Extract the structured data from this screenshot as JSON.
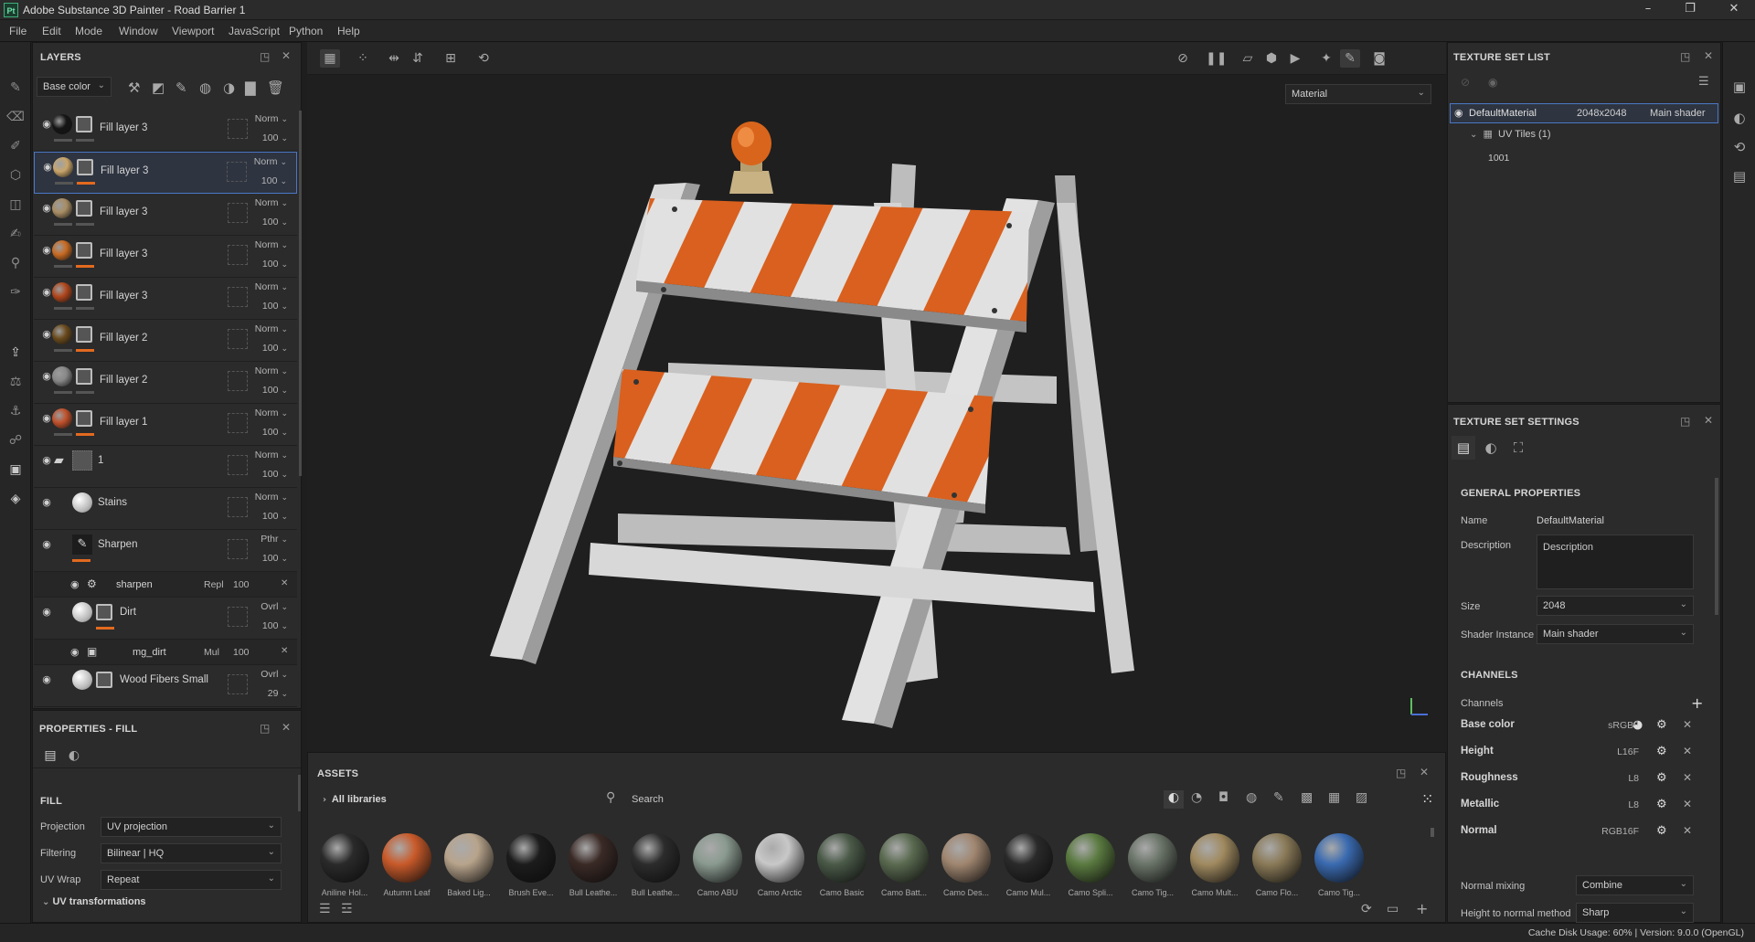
{
  "window": {
    "title": "Adobe Substance 3D Painter - Road Barrier 1",
    "app_icon": "Pt"
  },
  "menu": [
    "File",
    "Edit",
    "Mode",
    "Window",
    "Viewport",
    "JavaScript",
    "Python",
    "Help"
  ],
  "layers": {
    "title": "LAYERS",
    "channel_select": "Base color",
    "rows": [
      {
        "name": "Fill layer 3",
        "blend": "Norm",
        "opacity": "100",
        "thumb": "#151515",
        "bar": "gray"
      },
      {
        "name": "Fill layer 3",
        "blend": "Norm",
        "opacity": "100",
        "thumb": "#c9a56a",
        "bar": "orange",
        "selected": true
      },
      {
        "name": "Fill layer 3",
        "blend": "Norm",
        "opacity": "100",
        "thumb": "#a88d64",
        "bar": "gray"
      },
      {
        "name": "Fill layer 3",
        "blend": "Norm",
        "opacity": "100",
        "thumb": "#c86a22",
        "bar": "orange"
      },
      {
        "name": "Fill layer 3",
        "blend": "Norm",
        "opacity": "100",
        "thumb": "#b0461c",
        "bar": "gray"
      },
      {
        "name": "Fill layer 2",
        "blend": "Norm",
        "opacity": "100",
        "thumb": "#6a4a1c",
        "bar": "orange"
      },
      {
        "name": "Fill layer 2",
        "blend": "Norm",
        "opacity": "100",
        "thumb": "#888888",
        "bar": "gray"
      },
      {
        "name": "Fill layer 1",
        "blend": "Norm",
        "opacity": "100",
        "thumb": "#c0502a",
        "bar": "orange"
      }
    ],
    "folder": {
      "name": "1",
      "blend": "Norm",
      "opacity": "100"
    },
    "stains": {
      "name": "Stains",
      "blend": "Norm",
      "opacity": "100"
    },
    "sharpen": {
      "name": "Sharpen",
      "blend": "Pthr",
      "opacity": "100"
    },
    "sharpen_effect": {
      "name": "sharpen",
      "blend": "Repl",
      "opacity": "100"
    },
    "dirt": {
      "name": "Dirt",
      "blend": "Ovrl",
      "opacity": "100"
    },
    "dirt_mask": {
      "name": "mg_dirt",
      "blend": "Mul",
      "opacity": "100"
    },
    "wood": {
      "name": "Wood Fibers Small",
      "blend": "Ovrl",
      "opacity": "29"
    }
  },
  "properties": {
    "title": "PROPERTIES - FILL",
    "section": "FILL",
    "projection_label": "Projection",
    "projection_value": "UV projection",
    "filtering_label": "Filtering",
    "filtering_value": "Bilinear | HQ",
    "uvwrap_label": "UV Wrap",
    "uvwrap_value": "Repeat",
    "uv_transformations": "UV transformations"
  },
  "viewport": {
    "view_mode": "Material"
  },
  "assets": {
    "title": "ASSETS",
    "library": "All libraries",
    "search_placeholder": "Search",
    "materials": [
      {
        "label": "Aniline Hol...",
        "color": "#2a2a2a"
      },
      {
        "label": "Autumn Leaf",
        "color": "#c85a2a"
      },
      {
        "label": "Baked Lig...",
        "color": "#b8a48c"
      },
      {
        "label": "Brush Eve...",
        "color": "#1c1c1c"
      },
      {
        "label": "Bull Leathe...",
        "color": "#3a2a26"
      },
      {
        "label": "Bull Leathe...",
        "color": "#2c2c2c"
      },
      {
        "label": "Camo ABU",
        "color": "#8a9a90"
      },
      {
        "label": "Camo Arctic",
        "color": "#c8c8c8"
      },
      {
        "label": "Camo Basic",
        "color": "#4a5a48"
      },
      {
        "label": "Camo Batt...",
        "color": "#5a6a50"
      },
      {
        "label": "Camo Des...",
        "color": "#a08670"
      },
      {
        "label": "Camo Mul...",
        "color": "#2a2a2a"
      },
      {
        "label": "Camo Spli...",
        "color": "#5a7a40"
      },
      {
        "label": "Camo Tig...",
        "color": "#6a7468"
      },
      {
        "label": "Camo Mult...",
        "color": "#a08a60"
      },
      {
        "label": "Camo Flo...",
        "color": "#8a7a58"
      },
      {
        "label": "Camo Tig...",
        "color": "#3a6ab0"
      }
    ]
  },
  "texture_set_list": {
    "title": "TEXTURE SET LIST",
    "material": "DefaultMaterial",
    "resolution": "2048x2048",
    "shader": "Main shader",
    "uv_tiles": "UV Tiles (1)",
    "tile_id": "1001"
  },
  "texture_set_settings": {
    "title": "TEXTURE SET SETTINGS",
    "general": "GENERAL PROPERTIES",
    "name_label": "Name",
    "name_value": "DefaultMaterial",
    "description_label": "Description",
    "description_value": "Description",
    "size_label": "Size",
    "size_value": "2048",
    "shader_label": "Shader Instance",
    "shader_value": "Main shader",
    "channels_title": "CHANNELS",
    "channels_label": "Channels",
    "channels": [
      {
        "name": "Base color",
        "format": "sRGB8"
      },
      {
        "name": "Height",
        "format": "L16F"
      },
      {
        "name": "Roughness",
        "format": "L8"
      },
      {
        "name": "Metallic",
        "format": "L8"
      },
      {
        "name": "Normal",
        "format": "RGB16F"
      }
    ],
    "normal_mixing_label": "Normal mixing",
    "normal_mixing_value": "Combine",
    "height_to_normal_label": "Height to normal method",
    "height_to_normal_value": "Sharp"
  },
  "status": "Cache Disk Usage:   60% | Version: 9.0.0 (OpenGL)",
  "colors": {
    "accent": "#e36a1f",
    "selection": "#4a78c6",
    "panel": "#2b2b2b"
  }
}
